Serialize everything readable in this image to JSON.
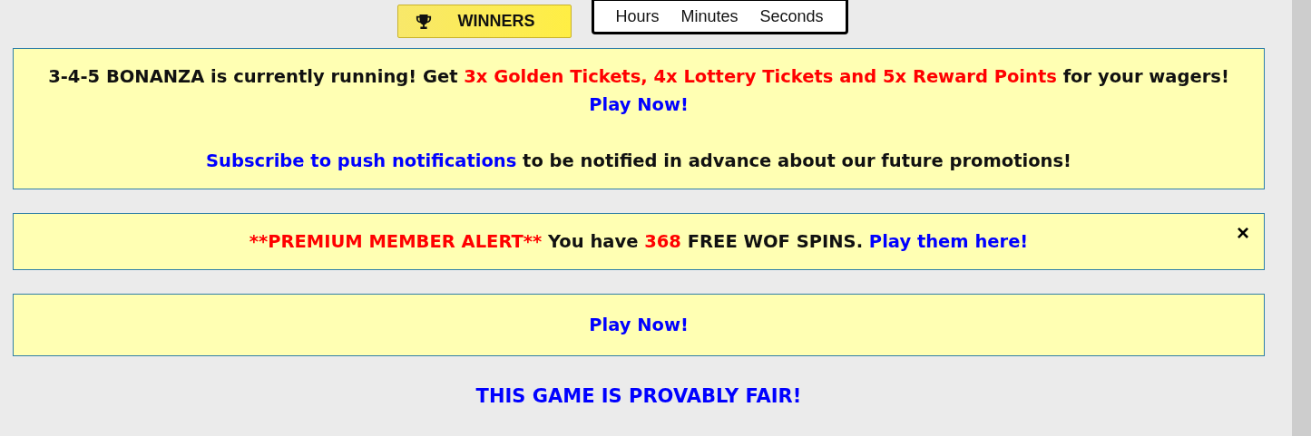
{
  "winners_button": {
    "label": "WINNERS"
  },
  "countdown": {
    "units": [
      "Hours",
      "Minutes",
      "Seconds"
    ]
  },
  "banners": [
    {
      "paragraphs": [
        [
          {
            "kind": "plain",
            "text": "3-4-5 BONANZA is currently running! Get "
          },
          {
            "kind": "highlight",
            "text": "3x Golden Tickets, 4x Lottery Tickets and 5x Reward Points"
          },
          {
            "kind": "plain",
            "text": " for your wagers! "
          },
          {
            "kind": "link",
            "text": "Play Now!"
          }
        ],
        [
          {
            "kind": "link",
            "text": "Subscribe to push notifications"
          },
          {
            "kind": "plain",
            "text": " to be notified in advance about our future promotions!"
          }
        ]
      ]
    },
    {
      "close_label": "×",
      "paragraphs": [
        [
          {
            "kind": "highlight",
            "text": "**PREMIUM MEMBER ALERT**"
          },
          {
            "kind": "plain",
            "text": " You have "
          },
          {
            "kind": "highlight",
            "text": "368"
          },
          {
            "kind": "plain",
            "text": " FREE WOF SPINS. "
          },
          {
            "kind": "link",
            "text": "Play them here!"
          }
        ]
      ]
    },
    {
      "paragraphs": [
        [
          {
            "kind": "link",
            "text": "Play Now!"
          }
        ]
      ]
    }
  ],
  "fair_heading": "THIS GAME IS PROVABLY FAIR!"
}
